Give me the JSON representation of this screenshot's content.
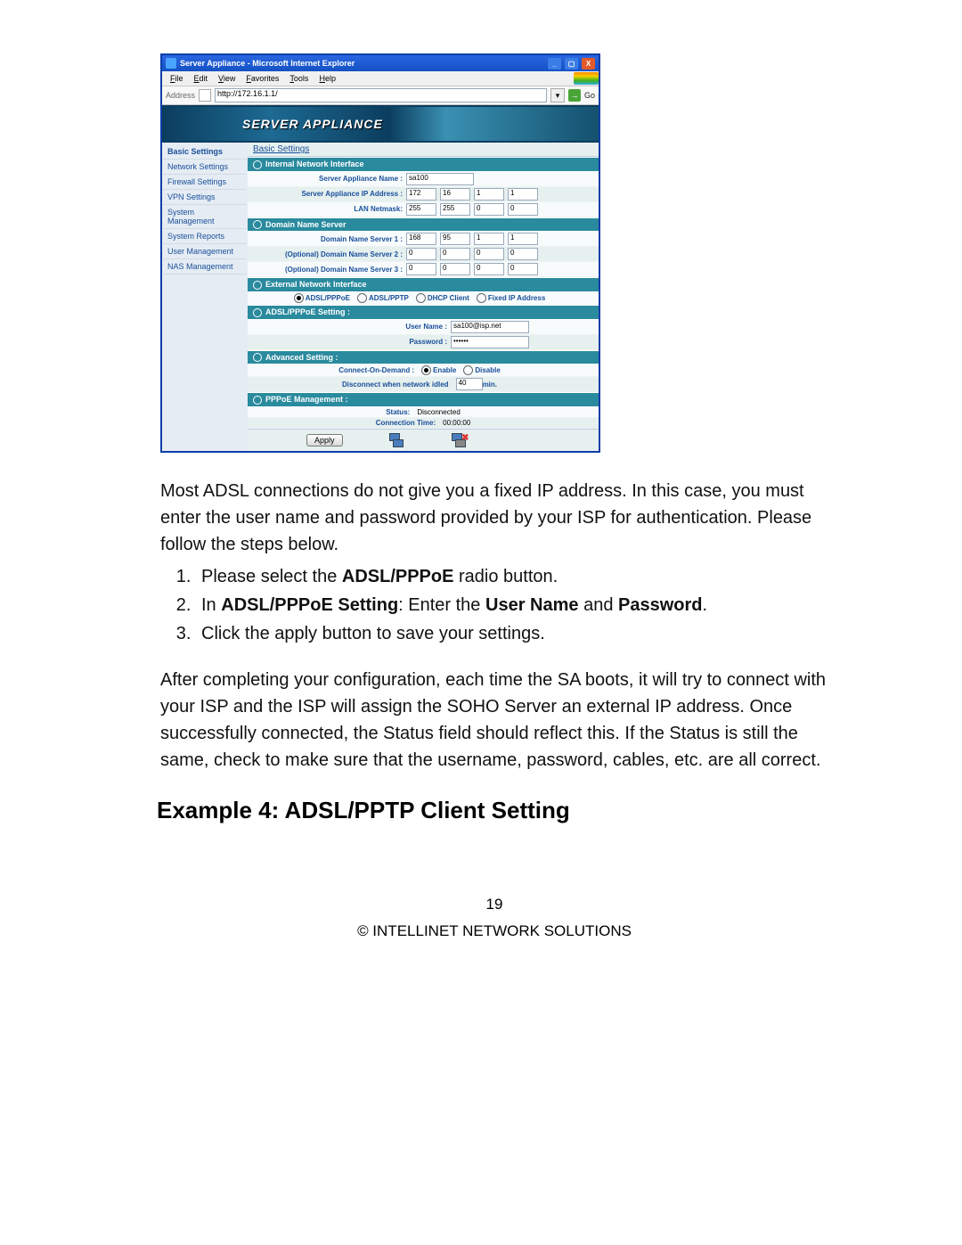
{
  "browser": {
    "title": "Server Appliance - Microsoft Internet Explorer",
    "menu": {
      "file": "File",
      "edit": "Edit",
      "view": "View",
      "fav": "Favorites",
      "tools": "Tools",
      "help": "Help"
    },
    "addr_label": "Address",
    "url": "http://172.16.1.1/",
    "go_label": "Go"
  },
  "banner": "SERVER APPLIANCE",
  "sidebar": {
    "items": [
      "Basic Settings",
      "Network Settings",
      "Firewall Settings",
      "VPN Settings",
      "System Management",
      "System Reports",
      "User Management",
      "NAS Management"
    ]
  },
  "tab_title": "Basic Settings",
  "sections": {
    "internal": {
      "title": "Internal Network Interface",
      "name_label": "Server Appliance Name :",
      "name_value": "sa100",
      "ip_label": "Server Appliance IP Address :",
      "ip": [
        "172",
        "16",
        "1",
        "1"
      ],
      "netmask_label": "LAN Netmask:",
      "netmask": [
        "255",
        "255",
        "0",
        "0"
      ]
    },
    "dns": {
      "title": "Domain Name Server",
      "d1_label": "Domain Name Server 1 :",
      "d1": [
        "168",
        "95",
        "1",
        "1"
      ],
      "d2_label": "(Optional) Domain Name Server 2 :",
      "d2": [
        "0",
        "0",
        "0",
        "0"
      ],
      "d3_label": "(Optional) Domain Name Server 3 :",
      "d3": [
        "0",
        "0",
        "0",
        "0"
      ]
    },
    "external": {
      "title": "External Network Interface",
      "r1": "ADSL/PPPoE",
      "r2": "ADSL/PPTP",
      "r3": "DHCP Client",
      "r4": "Fixed IP Address"
    },
    "pppoe": {
      "title": "ADSL/PPPoE Setting :",
      "user_label": "User Name :",
      "user_value": "sa100@isp.net",
      "pw_label": "Password :",
      "pw_value": "••••••"
    },
    "advanced": {
      "title": "Advanced Setting :",
      "cod_label": "Connect-On-Demand :",
      "enable": "Enable",
      "disable": "Disable",
      "idle_pre": "Disconnect when network idled",
      "idle_val": "40",
      "idle_post": "min."
    },
    "mgmt": {
      "title": "PPPoE Management :",
      "status_label": "Status:",
      "status_value": "Disconnected",
      "ct_label": "Connection Time:",
      "ct_value": "00:00:00"
    }
  },
  "apply_label": "Apply",
  "prose": {
    "p1a": "Most ADSL connections do not give you a fixed IP address. In this case, you must enter the user name and password provided by your ISP for authentication. Please follow the steps below.",
    "li1_a": "Please select the ",
    "li1_b": "ADSL/PPPoE",
    "li1_c": " radio button.",
    "li2_a": "In ",
    "li2_b": "ADSL/PPPoE Setting",
    "li2_c": ": Enter the ",
    "li2_d": "User Name",
    "li2_e": " and ",
    "li2_f": "Password",
    "li2_g": ".",
    "li3": "Click the apply button to save your settings.",
    "p2": "After completing your configuration, each time the SA boots, it will try to connect with your ISP and the ISP will assign the SOHO Server   an external IP address. Once successfully connected, the Status field should reflect this. If the Status is still the same, check to make sure that the username, password, cables, etc. are all correct."
  },
  "heading": "Example 4: ADSL/PPTP Client Setting",
  "footer": {
    "page": "19",
    "org": "© INTELLINET NETWORK SOLUTIONS"
  }
}
